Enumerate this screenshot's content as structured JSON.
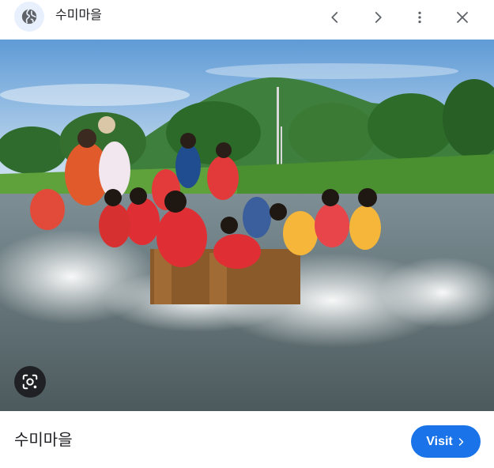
{
  "header": {
    "site_name": "수미마을",
    "site_icon": "globe-icon",
    "prev_icon": "chevron-left-icon",
    "next_icon": "chevron-right-icon",
    "more_icon": "more-vert-icon",
    "close_icon": "close-icon"
  },
  "image": {
    "lens_icon": "camera-lens-icon"
  },
  "info": {
    "title": "수미마을",
    "visit_label": "Visit",
    "visit_icon": "chevron-right-icon"
  },
  "colors": {
    "accent": "#1a73e8",
    "icon_bg": "#e8f0fe",
    "icon": "#5f6368"
  }
}
